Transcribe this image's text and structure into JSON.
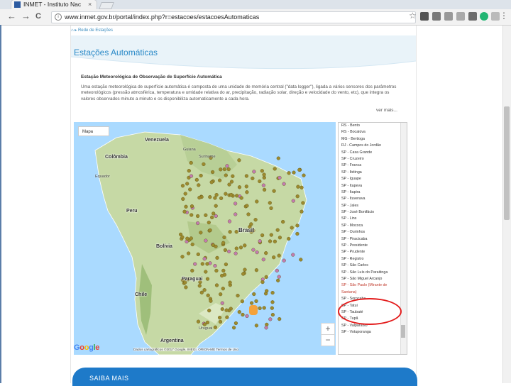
{
  "browser": {
    "tab_title": "INMET - Instituto Nac",
    "tab_close": "×",
    "url": "www.inmet.gov.br/portal/index.php?r=estacoes/estacoesAutomaticas",
    "back": "←",
    "forward": "→",
    "reload": "C",
    "star": "☆",
    "menu": "⋮"
  },
  "page": {
    "breadcrumb": "⌂ ▸ Rede de Estações",
    "title": "Estações Automáticas",
    "section_title": "Estação Meteorológica de Observação de Superfície Automática",
    "description": "Uma estação meteorológica de superfície automática é composta de uma unidade de memória central (\"data logger\"), ligada a vários sensores dos parâmetros meteorológicos (pressão atmosférica, temperatura e umidade relativa do ar, precipitação, radiação solar, direção e velocidade do vento, etc), que integra os valores observados minuto a minuto e os disponibiliza automaticamente a cada hora.",
    "more_link": "ver mais..."
  },
  "map": {
    "map_type": "Mapa",
    "zoom_in": "+",
    "zoom_out": "−",
    "logo": "Google",
    "attribution": "Dados cartográficos ©2017 Google, INEGI, ORION-ME  Termos de Uso",
    "countries": [
      {
        "label": "Venezuela"
      },
      {
        "label": "Colômbia"
      },
      {
        "label": "Guiana"
      },
      {
        "label": "Suriname"
      },
      {
        "label": "Equador"
      },
      {
        "label": "Peru"
      },
      {
        "label": "Bolívia"
      },
      {
        "label": "Paraguai"
      },
      {
        "label": "Chile"
      },
      {
        "label": "Argentina"
      },
      {
        "label": "Uruguai"
      },
      {
        "label": "Brasil"
      }
    ]
  },
  "stations": [
    "RS - Bento",
    "RS - Bocaiúva",
    "MG - Bertioga",
    "RJ - Campos do Jordão",
    "SP - Casa Grande",
    "SP - Cruzeiro",
    "SP - Franca",
    "SP - Ibitinga",
    "SP - Iguape",
    "SP - Itapeva",
    "SP - Itapira",
    "SP - Ituverava",
    "SP - Jales",
    "SP - José Bonifácio",
    "SP - Lins",
    "SP - Mococa",
    "SP - Ourinhos",
    "SP - Piracicaba",
    "SP - Presidente",
    "SP - Prudente",
    "SP - Registro",
    "SP - São Carlos",
    "SP - São Luís do Paraitinga",
    "SP - São Miguel Arcanjo",
    "SP - São Paulo (Mirante de",
    "Santana)",
    "SP - Sorocaba",
    "SP - Tatui",
    "SP - Taubaté",
    "SP - Tupã",
    "SP - Valparaíso",
    "SP - Votuporanga"
  ],
  "highlighted_station_index": 24,
  "footer": {
    "label": "SAIBA MAIS"
  }
}
